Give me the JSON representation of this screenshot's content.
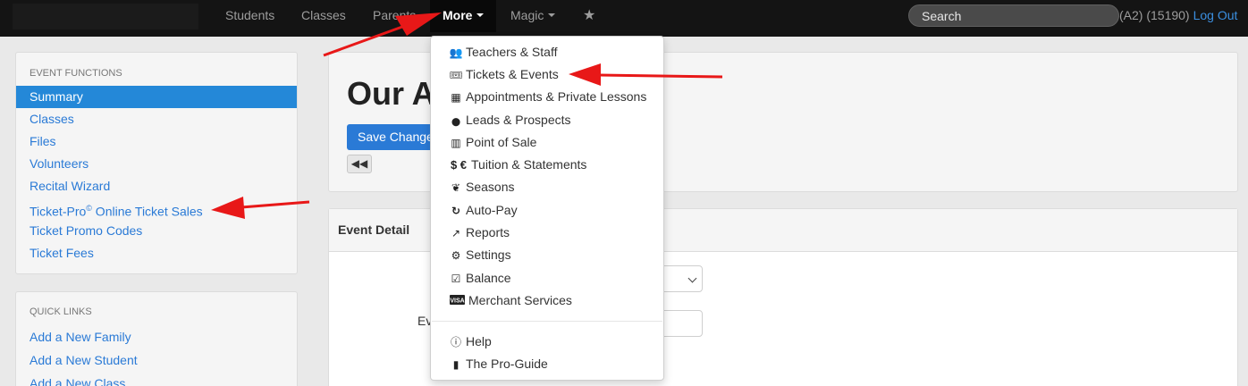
{
  "navbar": {
    "items": [
      {
        "label": "Students"
      },
      {
        "label": "Classes"
      },
      {
        "label": "Parents"
      },
      {
        "label": "More"
      },
      {
        "label": "Magic"
      },
      {
        "label": "★"
      }
    ],
    "search_placeholder": "Search",
    "account_info": "(A2) (15190)",
    "logout_label": "Log Out"
  },
  "sidebar": {
    "event_heading": "EVENT FUNCTIONS",
    "event_items": [
      {
        "label": "Summary"
      },
      {
        "label": "Classes"
      },
      {
        "label": "Files"
      },
      {
        "label": "Volunteers"
      },
      {
        "label": "Recital Wizard"
      },
      {
        "label": "Ticket-Pro",
        "sup": "©",
        "rest": " Online Ticket Sales"
      },
      {
        "label": "Ticket Promo Codes"
      },
      {
        "label": "Ticket Fees"
      }
    ],
    "quick_heading": "QUICK LINKS",
    "quick_items": [
      {
        "label": "Add a New Family"
      },
      {
        "label": "Add a New Student"
      },
      {
        "label": "Add a New Class"
      }
    ]
  },
  "main": {
    "title": "Our A",
    "save_label": "Save Changes",
    "back_icon": "fast-backward-icon",
    "event_detail_heading": "Event Detail",
    "field_label_partial": "Ev"
  },
  "dropdown": {
    "items": [
      {
        "icon": "users-icon",
        "glyph": "👥",
        "label": "Teachers & Staff"
      },
      {
        "icon": "ticket-icon",
        "glyph": "🎟",
        "label": "Tickets & Events"
      },
      {
        "icon": "calendar-icon",
        "glyph": "▦",
        "label": "Appointments & Private Lessons"
      },
      {
        "icon": "map-marker-icon",
        "glyph": "⬤",
        "label": "Leads & Prospects"
      },
      {
        "icon": "barcode-icon",
        "glyph": "▥",
        "label": "Point of Sale"
      },
      {
        "icon": "currency-icon",
        "glyph": "$ €",
        "label": "Tuition & Statements"
      },
      {
        "icon": "leaf-icon",
        "glyph": "❦",
        "label": "Seasons"
      },
      {
        "icon": "refresh-icon",
        "glyph": "↻",
        "label": "Auto-Pay"
      },
      {
        "icon": "chart-line-icon",
        "glyph": "↗",
        "label": "Reports"
      },
      {
        "icon": "gears-icon",
        "glyph": "⚙",
        "label": "Settings"
      },
      {
        "icon": "check-square-icon",
        "glyph": "☑",
        "label": "Balance"
      },
      {
        "icon": "credit-card-icon",
        "glyph": "▭",
        "label": "Merchant Services"
      }
    ],
    "help_items": [
      {
        "icon": "info-circle-icon",
        "glyph": "ⓘ",
        "label": "Help"
      },
      {
        "icon": "book-icon",
        "glyph": "▮",
        "label": "The Pro-Guide"
      }
    ]
  },
  "colors": {
    "navbar_bg": "#141414",
    "link": "#2a7ad6",
    "active_bg": "#2488d8",
    "arrow": "#e81818"
  }
}
